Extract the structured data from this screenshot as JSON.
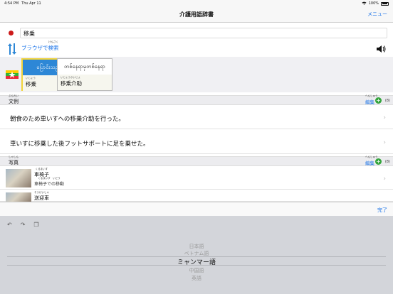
{
  "status": {
    "time": "4:54 PM",
    "date": "Thu Apr 11",
    "battery": "100%"
  },
  "nav": {
    "title": "介護用語辞書",
    "menu_label": "メニュー"
  },
  "source": {
    "value": "移乗"
  },
  "browser_search": {
    "ruby": "けんさく",
    "label_a": "ブラウザで",
    "label_b": "検索"
  },
  "translations": [
    {
      "myanmar": "ပြောင်းသည်",
      "ruby": "いじょう",
      "japanese": "移乗"
    },
    {
      "myanmar": "တစ်နေရာမှတစ်နေရာ",
      "ruby": "いじょうかいじょ",
      "japanese": "移乗介助"
    }
  ],
  "examples_section": {
    "ruby": "ぶんれい",
    "title": "文例",
    "edit_ruby": "へんしゅう",
    "edit": "編集",
    "count": "(8)"
  },
  "examples": [
    {
      "text": "朝食のため車いすへの移乗介助を行った。"
    },
    {
      "text": "車いすに移乗した後フットサポートに足を乗せた。"
    }
  ],
  "photos_section": {
    "ruby": "しゃしん",
    "title": "写真",
    "edit_ruby": "へんしゅう",
    "edit": "編集",
    "count": "(8)"
  },
  "photos": [
    {
      "title_ruby": "くるまいす",
      "title": "車椅子",
      "sub_ruby": "くるまいす　いどう",
      "sub": "車椅子での移動"
    },
    {
      "title_ruby": "そうげいしゃ",
      "title": "送迎車",
      "sub_ruby": "",
      "sub": ""
    }
  ],
  "toolbar": {
    "done": "完了"
  },
  "picker": {
    "items": [
      "日本語",
      "ベトナム語",
      "ミャンマー語",
      "中国語",
      "英語"
    ],
    "selected_index": 2
  }
}
